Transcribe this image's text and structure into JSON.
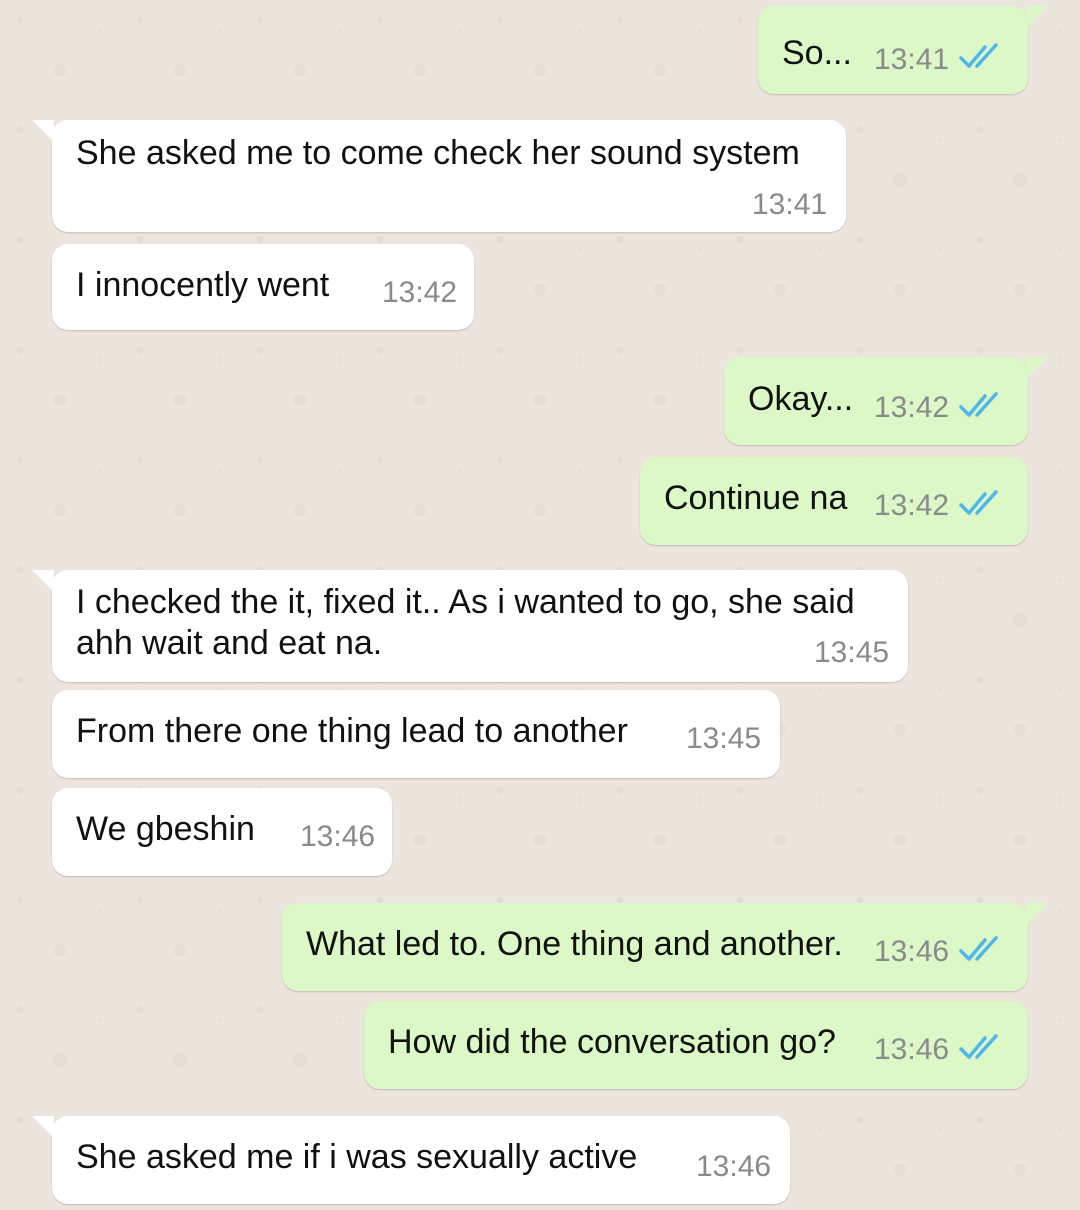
{
  "colors": {
    "incoming_bubble": "#ffffff",
    "outgoing_bubble": "#dcf8c6",
    "read_ticks": "#4fb6ec",
    "timestamp": "#8a8a8a",
    "chat_background": "#ece5dd"
  },
  "messages": [
    {
      "direction": "out",
      "text": "So...",
      "time": "13:41",
      "status_icon": "double-check-read-icon"
    },
    {
      "direction": "in",
      "text": "She asked me to come check her sound system",
      "time": "13:41"
    },
    {
      "direction": "in",
      "text": "I innocently went",
      "time": "13:42"
    },
    {
      "direction": "out",
      "text": "Okay...",
      "time": "13:42",
      "status_icon": "double-check-read-icon"
    },
    {
      "direction": "out",
      "text": "Continue na",
      "time": "13:42",
      "status_icon": "double-check-read-icon"
    },
    {
      "direction": "in",
      "text_line1": "I checked the it, fixed it.. As i wanted to go, she said",
      "text_line2": "ahh wait and eat na.",
      "time": "13:45"
    },
    {
      "direction": "in",
      "text": "From there one thing lead to another",
      "time": "13:45"
    },
    {
      "direction": "in",
      "text": "We gbeshin",
      "time": "13:46"
    },
    {
      "direction": "out",
      "text": "What led to. One thing and another.",
      "time": "13:46",
      "status_icon": "double-check-read-icon"
    },
    {
      "direction": "out",
      "text": "How did the conversation go?",
      "time": "13:46",
      "status_icon": "double-check-read-icon"
    },
    {
      "direction": "in",
      "text": "She asked me if i was sexually active",
      "time": "13:46"
    }
  ]
}
